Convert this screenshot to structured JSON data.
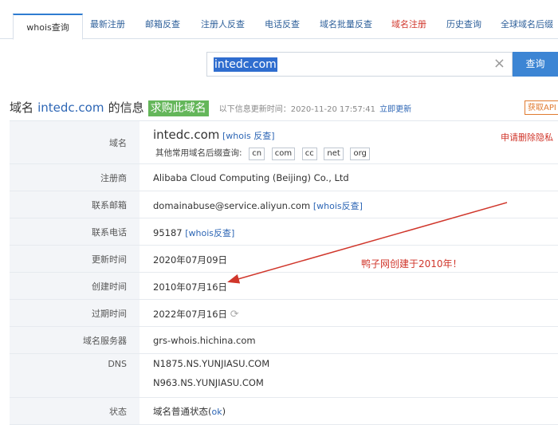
{
  "tabs": [
    {
      "label": "whois查询",
      "active": true
    },
    {
      "label": "最新注册"
    },
    {
      "label": "邮箱反查"
    },
    {
      "label": "注册人反查"
    },
    {
      "label": "电话反查"
    },
    {
      "label": "域名批量反查"
    },
    {
      "label": "域名注册",
      "color": "#d0362b"
    },
    {
      "label": "历史查询"
    },
    {
      "label": "全球域名后缀"
    }
  ],
  "search": {
    "value": "intedc.com",
    "clear_icon": "close-icon",
    "button_label": "查询"
  },
  "info": {
    "prefix": "域名",
    "domain": "intedc.com",
    "suffix": "的信息",
    "buy_label": "求购此域名",
    "update_text": "以下信息更新时间：2020-11-20 17:57:41",
    "update_link": "立即更新",
    "api_label": "获取API"
  },
  "whois": {
    "domain_row": {
      "label": "域名",
      "domain": "intedc.com",
      "whois_link": "[whois 反查]",
      "suffix_label": "其他常用域名后缀查询:",
      "suffixes": [
        "cn",
        "com",
        "cc",
        "net",
        "org"
      ],
      "delete_privacy": "申请删除隐私"
    },
    "registrar": {
      "label": "注册商",
      "value": "Alibaba Cloud Computing (Beijing) Co., Ltd"
    },
    "email": {
      "label": "联系邮箱",
      "value": "domainabuse@service.aliyun.com",
      "link": "[whois反查]"
    },
    "phone": {
      "label": "联系电话",
      "value": "95187",
      "link": "[whois反查]"
    },
    "updated": {
      "label": "更新时间",
      "value": "2020年07月09日"
    },
    "created": {
      "label": "创建时间",
      "value": "2010年07月16日"
    },
    "expires": {
      "label": "过期时间",
      "value": "2022年07月16日",
      "icon": "refresh-icon"
    },
    "server": {
      "label": "域名服务器",
      "value": "grs-whois.hichina.com"
    },
    "dns": {
      "label": "DNS",
      "values": [
        "N1875.NS.YUNJIASU.COM",
        "N963.NS.YUNJIASU.COM"
      ]
    },
    "status": {
      "label": "状态",
      "prefix": "域名普通状态(",
      "link": "ok",
      "suffix": ")"
    }
  },
  "annotation": {
    "note": "鸭子网创建于2010年！",
    "color": "#d0362b"
  }
}
